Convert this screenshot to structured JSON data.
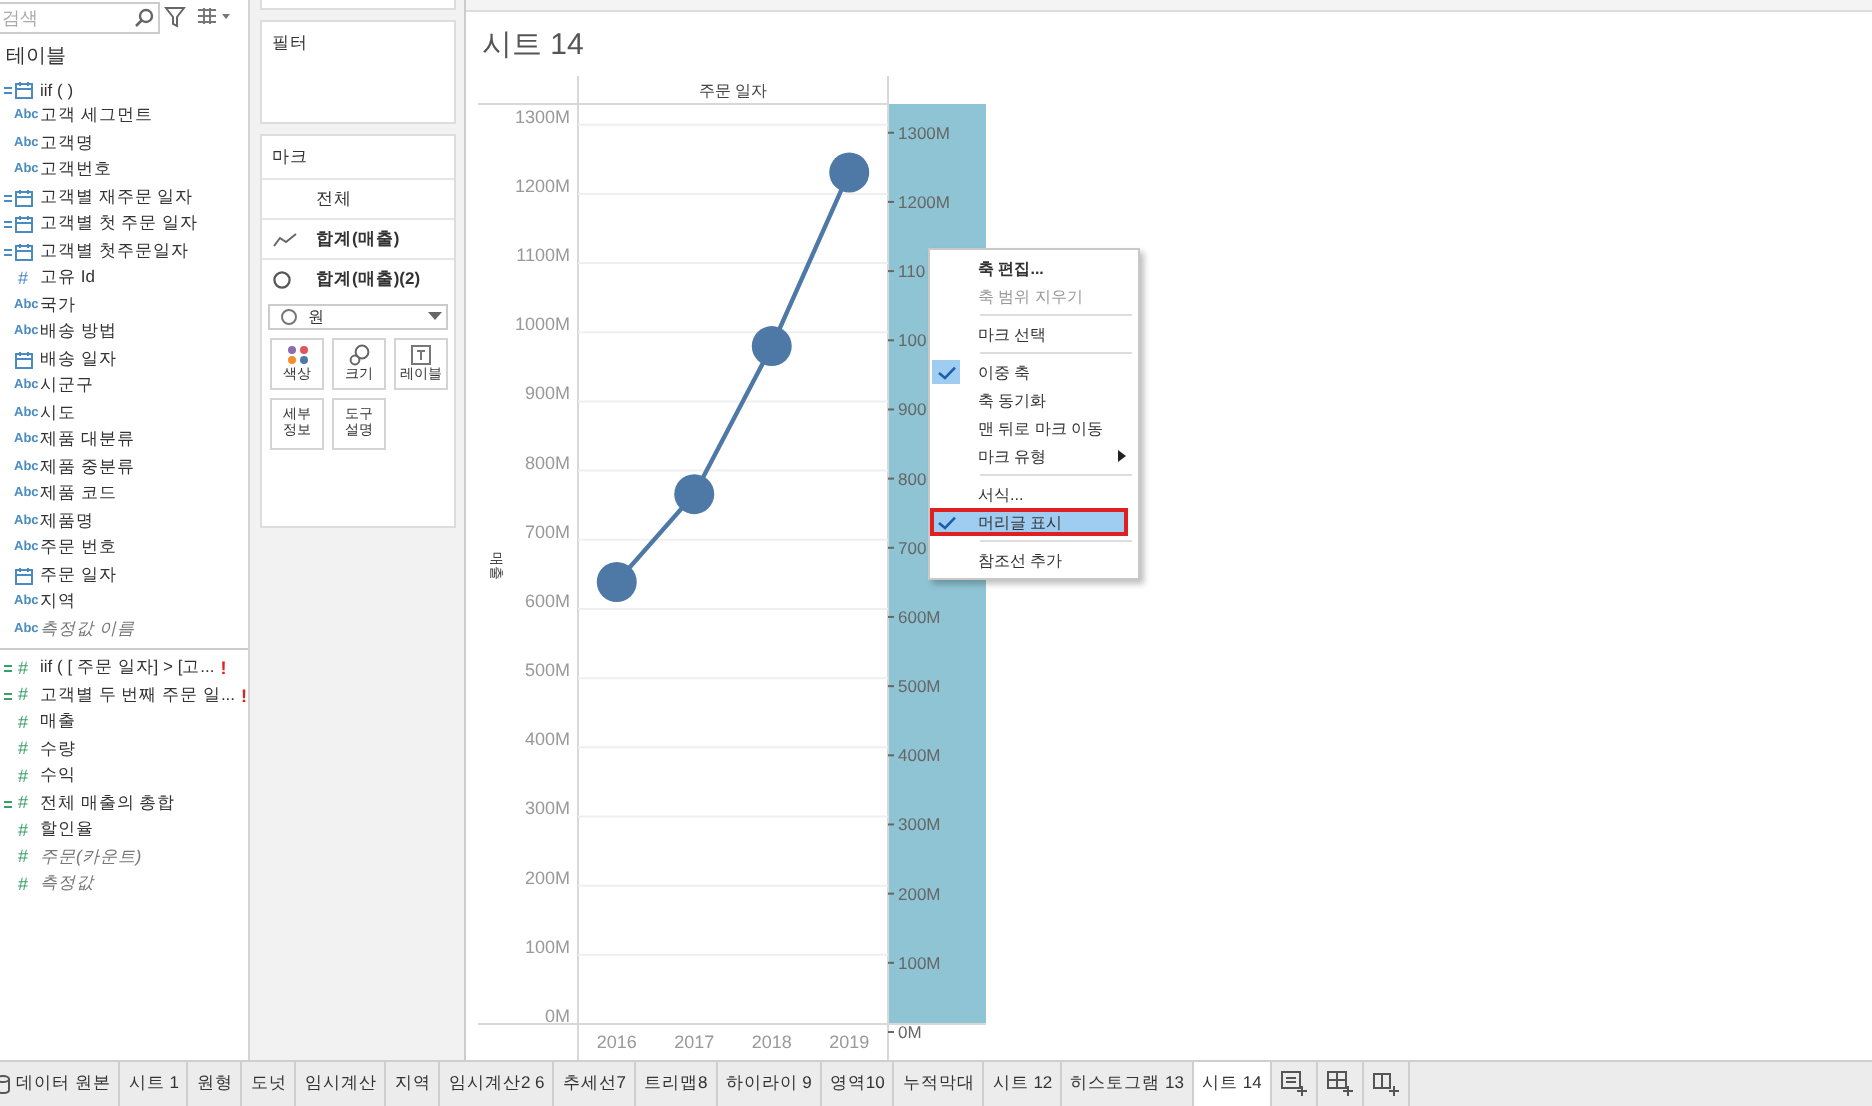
{
  "search": {
    "placeholder": "검색"
  },
  "data_pane": {
    "title": "테이블",
    "sections": [
      {
        "kind": "dimension",
        "fields": [
          {
            "kind": "date",
            "calc": true,
            "italic": false,
            "label": "iif ( )"
          },
          {
            "kind": "string",
            "calc": false,
            "italic": false,
            "badge": "Abc",
            "label": "고객 세그먼트"
          },
          {
            "kind": "string",
            "calc": false,
            "italic": false,
            "badge": "Abc",
            "label": "고객명"
          },
          {
            "kind": "string",
            "calc": false,
            "italic": false,
            "badge": "Abc",
            "label": "고객번호"
          },
          {
            "kind": "date",
            "calc": true,
            "italic": false,
            "label": "고객별 재주문 일자"
          },
          {
            "kind": "date",
            "calc": true,
            "italic": false,
            "label": "고객별 첫 주문 일자"
          },
          {
            "kind": "date",
            "calc": true,
            "italic": false,
            "label": "고객별 첫주문일자"
          },
          {
            "kind": "number",
            "calc": false,
            "italic": false,
            "badge": "#",
            "label": "고유 Id"
          },
          {
            "kind": "string",
            "calc": false,
            "italic": false,
            "badge": "Abc",
            "label": "국가"
          },
          {
            "kind": "string",
            "calc": false,
            "italic": false,
            "badge": "Abc",
            "label": "배송 방법"
          },
          {
            "kind": "date",
            "calc": false,
            "italic": false,
            "label": "배송 일자"
          },
          {
            "kind": "string",
            "calc": false,
            "italic": false,
            "badge": "Abc",
            "label": "시군구"
          },
          {
            "kind": "string",
            "calc": false,
            "italic": false,
            "badge": "Abc",
            "label": "시도"
          },
          {
            "kind": "string",
            "calc": false,
            "italic": false,
            "badge": "Abc",
            "label": "제품 대분류"
          },
          {
            "kind": "string",
            "calc": false,
            "italic": false,
            "badge": "Abc",
            "label": "제품 중분류"
          },
          {
            "kind": "string",
            "calc": false,
            "italic": false,
            "badge": "Abc",
            "label": "제품 코드"
          },
          {
            "kind": "string",
            "calc": false,
            "italic": false,
            "badge": "Abc",
            "label": "제품명"
          },
          {
            "kind": "string",
            "calc": false,
            "italic": false,
            "badge": "Abc",
            "label": "주문 번호"
          },
          {
            "kind": "date",
            "calc": false,
            "italic": false,
            "label": "주문 일자"
          },
          {
            "kind": "string",
            "calc": false,
            "italic": false,
            "badge": "Abc",
            "label": "지역"
          },
          {
            "kind": "string",
            "calc": false,
            "italic": true,
            "badge": "Abc",
            "label": "측정값 이름"
          }
        ]
      },
      {
        "kind": "measure",
        "fields": [
          {
            "kind": "number",
            "calc": true,
            "italic": false,
            "badge": "#",
            "label": "iif ( [ 주문 일자] > [고...",
            "warning": "!"
          },
          {
            "kind": "number",
            "calc": true,
            "italic": false,
            "badge": "#",
            "label": "고객별 두 번째 주문 일...",
            "warning": "!"
          },
          {
            "kind": "number",
            "calc": false,
            "italic": false,
            "badge": "#",
            "label": "매출"
          },
          {
            "kind": "number",
            "calc": false,
            "italic": false,
            "badge": "#",
            "label": "수량"
          },
          {
            "kind": "number",
            "calc": false,
            "italic": false,
            "badge": "#",
            "label": "수익"
          },
          {
            "kind": "number",
            "calc": true,
            "italic": false,
            "badge": "#",
            "label": "전체 매출의 총합"
          },
          {
            "kind": "number",
            "calc": false,
            "italic": false,
            "badge": "#",
            "label": "할인율"
          },
          {
            "kind": "number",
            "calc": false,
            "italic": true,
            "badge": "#",
            "label": "주문(카운트)"
          },
          {
            "kind": "number",
            "calc": false,
            "italic": true,
            "badge": "#",
            "label": "측정값"
          }
        ]
      }
    ]
  },
  "filters": {
    "title": "필터"
  },
  "marks": {
    "title": "마크",
    "cards": [
      {
        "kind": "all",
        "label": "전체"
      },
      {
        "kind": "line",
        "label": "합계(매출)"
      },
      {
        "kind": "circle",
        "label": "합계(매출)(2)"
      }
    ],
    "mark_type": {
      "label": "원"
    },
    "buttons": [
      {
        "kind": "color",
        "label": "색상"
      },
      {
        "kind": "size",
        "label": "크기"
      },
      {
        "kind": "label",
        "label": "레이블"
      },
      {
        "kind": "detail",
        "label": "세부 정보"
      },
      {
        "kind": "tooltip",
        "label": "도구 설명"
      }
    ]
  },
  "sheet": {
    "title": "시트 14",
    "column_header": "주문 일자",
    "y_axis_title": "매출",
    "chart_data": {
      "type": "line",
      "categories": [
        "2016",
        "2017",
        "2018",
        "2019"
      ],
      "series": [
        {
          "color": "#4e79a7",
          "marker": true,
          "values": [
            639,
            766,
            980,
            1231
          ]
        }
      ],
      "grid": true,
      "ylim": [
        0,
        1330
      ],
      "yticks": [
        {
          "value": 1300,
          "label": "1300M"
        },
        {
          "value": 1200,
          "label": "1200M"
        },
        {
          "value": 1100,
          "label": "1100M"
        },
        {
          "value": 1000,
          "label": "1000M"
        },
        {
          "value": 900,
          "label": "900M"
        },
        {
          "value": 800,
          "label": "800M"
        },
        {
          "value": 700,
          "label": "700M"
        },
        {
          "value": 600,
          "label": "600M"
        },
        {
          "value": 500,
          "label": "500M"
        },
        {
          "value": 400,
          "label": "400M"
        },
        {
          "value": 300,
          "label": "300M"
        },
        {
          "value": 200,
          "label": "200M"
        },
        {
          "value": 100,
          "label": "100M"
        },
        {
          "value": 0,
          "label": "0M"
        }
      ]
    },
    "right_axis_labels": [
      "1300M",
      "1200M",
      "110",
      "100",
      "900",
      "800",
      "700",
      "600M",
      "500M",
      "400M",
      "300M",
      "200M",
      "100M",
      "0M"
    ]
  },
  "context_menu": {
    "items": [
      {
        "kind": "item",
        "label": "축 편집...",
        "bold": true,
        "disabled": false,
        "checked": false,
        "highlighted": false,
        "submenu": false
      },
      {
        "kind": "item",
        "label": "축 범위 지우기",
        "bold": false,
        "disabled": true,
        "checked": false,
        "highlighted": false,
        "submenu": false
      },
      {
        "kind": "separator"
      },
      {
        "kind": "item",
        "label": "마크 선택",
        "bold": false,
        "disabled": false,
        "checked": false,
        "highlighted": false,
        "submenu": false
      },
      {
        "kind": "separator"
      },
      {
        "kind": "item",
        "label": "이중 축",
        "bold": false,
        "disabled": false,
        "checked": true,
        "highlighted": false,
        "submenu": false
      },
      {
        "kind": "item",
        "label": "축 동기화",
        "bold": false,
        "disabled": false,
        "checked": false,
        "highlighted": false,
        "submenu": false
      },
      {
        "kind": "item",
        "label": "맨 뒤로 마크 이동",
        "bold": false,
        "disabled": false,
        "checked": false,
        "highlighted": false,
        "submenu": false
      },
      {
        "kind": "item",
        "label": "마크 유형",
        "bold": false,
        "disabled": false,
        "checked": false,
        "highlighted": false,
        "submenu": true
      },
      {
        "kind": "separator"
      },
      {
        "kind": "item",
        "label": "서식...",
        "bold": false,
        "disabled": false,
        "checked": false,
        "highlighted": false,
        "submenu": false
      },
      {
        "kind": "item",
        "label": "머리글 표시",
        "bold": false,
        "disabled": false,
        "checked": true,
        "highlighted": true,
        "submenu": false
      },
      {
        "kind": "separator"
      },
      {
        "kind": "item",
        "label": "참조선 추가",
        "bold": false,
        "disabled": false,
        "checked": false,
        "highlighted": false,
        "submenu": false
      }
    ]
  },
  "tabs": [
    {
      "kind": "datasource",
      "label": "데이터 원본",
      "selected": false
    },
    {
      "kind": "sheet",
      "label": "시트 1",
      "selected": false
    },
    {
      "kind": "sheet",
      "label": "원형",
      "selected": false
    },
    {
      "kind": "sheet",
      "label": "도넛",
      "selected": false
    },
    {
      "kind": "sheet",
      "label": "임시계산",
      "selected": false
    },
    {
      "kind": "sheet",
      "label": "지역",
      "selected": false
    },
    {
      "kind": "sheet",
      "label": "임시계산2 6",
      "selected": false
    },
    {
      "kind": "sheet",
      "label": "추세선7",
      "selected": false
    },
    {
      "kind": "sheet",
      "label": "트리맵8",
      "selected": false
    },
    {
      "kind": "sheet",
      "label": "하이라이 9",
      "selected": false
    },
    {
      "kind": "sheet",
      "label": "영역10",
      "selected": false
    },
    {
      "kind": "sheet",
      "label": "누적막대",
      "selected": false
    },
    {
      "kind": "sheet",
      "label": "시트 12",
      "selected": false
    },
    {
      "kind": "sheet",
      "label": "히스토그램 13",
      "selected": false
    },
    {
      "kind": "sheet",
      "label": "시트 14",
      "selected": true
    }
  ],
  "tab_actions": [
    {
      "kind": "new-sheet"
    },
    {
      "kind": "new-dashboard"
    },
    {
      "kind": "new-story"
    }
  ]
}
